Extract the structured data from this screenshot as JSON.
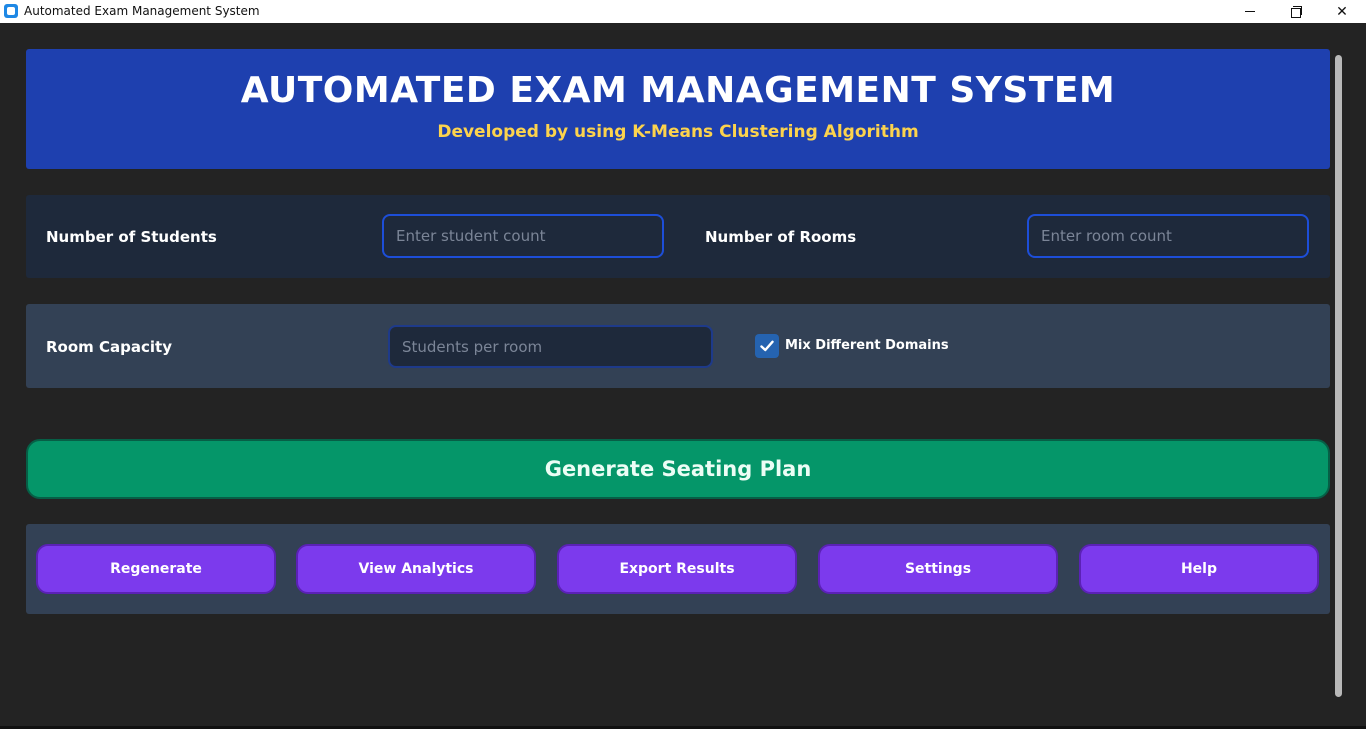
{
  "window": {
    "title": "Automated Exam Management System",
    "minimize_icon": "minimize-icon",
    "maximize_icon": "restore-icon",
    "close_icon": "close-icon",
    "close_glyph": "✕"
  },
  "header": {
    "title": "AUTOMATED EXAM MANAGEMENT SYSTEM",
    "subtitle": "Developed by using K-Means Clustering Algorithm",
    "background": "#1e40af",
    "subtitle_color": "#fcd34d"
  },
  "form": {
    "students_label": "Number of Students",
    "students_placeholder": "Enter student count",
    "students_value": "",
    "rooms_label": "Number of Rooms",
    "rooms_placeholder": "Enter room count",
    "rooms_value": "",
    "capacity_label": "Room Capacity",
    "capacity_placeholder": "Students per room",
    "capacity_value": "",
    "mix_domains_label": "Mix Different Domains",
    "mix_domains_checked": true
  },
  "generate": {
    "label": "Generate Seating Plan",
    "color": "#059669"
  },
  "actions": [
    {
      "label": "Regenerate"
    },
    {
      "label": "View Analytics"
    },
    {
      "label": "Export Results"
    },
    {
      "label": "Settings"
    },
    {
      "label": "Help"
    }
  ],
  "colors": {
    "accent_purple": "#7c3aed",
    "input_border": "#1d4ed8"
  }
}
